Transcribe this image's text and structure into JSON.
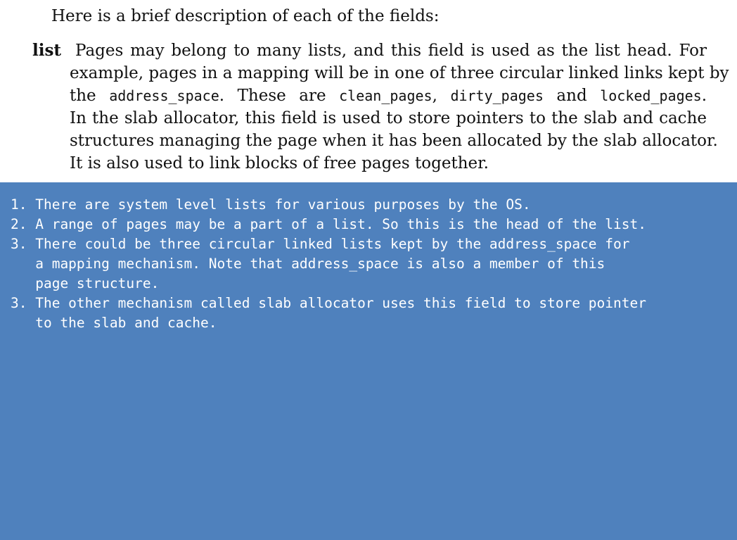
{
  "document": {
    "intro": "Here is a brief description of each of the fields:",
    "term": "list",
    "lines": {
      "l1": "Pages may belong to many lists, and this field is used as the list head. For",
      "l2": "example, pages in a mapping will be in one of three circular linked links kept by",
      "l3_a": "the ",
      "l3_code1": "address_space",
      "l3_b": ". These are ",
      "l3_code2": "clean_pages",
      "l3_c": ", ",
      "l3_code3": "dirty_pages",
      "l3_d": " and ",
      "l3_code4": "locked_pages",
      "l3_e": ".",
      "l4": "In the slab allocator, this field is used to store pointers to the slab and cache",
      "l5": "structures managing the page when it has been allocated by the slab allocator.",
      "l6": "It is also used to link blocks of free pages together."
    }
  },
  "notes": {
    "background": "#4f81bd",
    "lines": [
      "1. There are system level lists for various purposes by the OS.",
      "2. A range of pages may be a part of a list. So this is the head of the list.",
      "3. There could be three circular linked lists kept by the address_space for",
      "   a mapping mechanism. Note that address_space is also a member of this",
      "   page structure.",
      "3. The other mechanism called slab allocator uses this field to store pointer",
      "   to the slab and cache."
    ]
  }
}
